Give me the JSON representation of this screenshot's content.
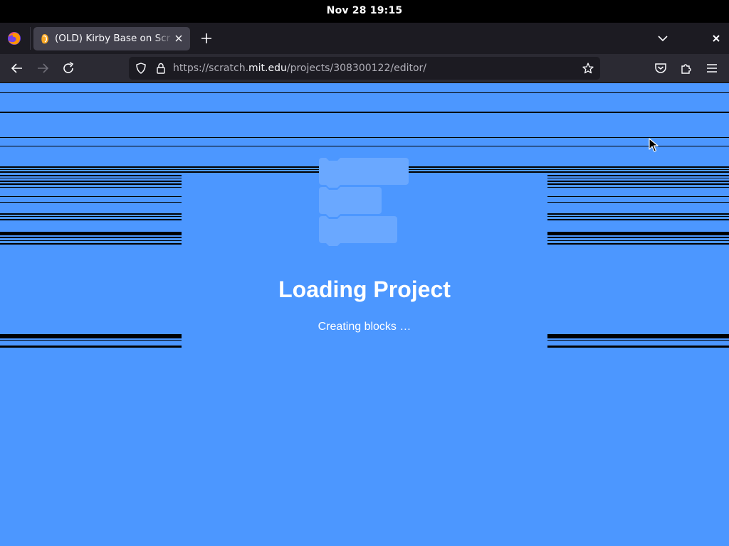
{
  "system": {
    "clock": "Nov 28  19:15"
  },
  "browser": {
    "tab": {
      "title": "(OLD) Kirby Base on Scratch"
    },
    "url": {
      "prefix": "https://scratch.",
      "domain": "mit.edu",
      "path": "/projects/308300122/editor/"
    }
  },
  "loader": {
    "title": "Loading Project",
    "message": "Creating blocks …"
  },
  "colors": {
    "scratch_blue": "#4c97ff",
    "block_tint": "#6aa8ff"
  }
}
